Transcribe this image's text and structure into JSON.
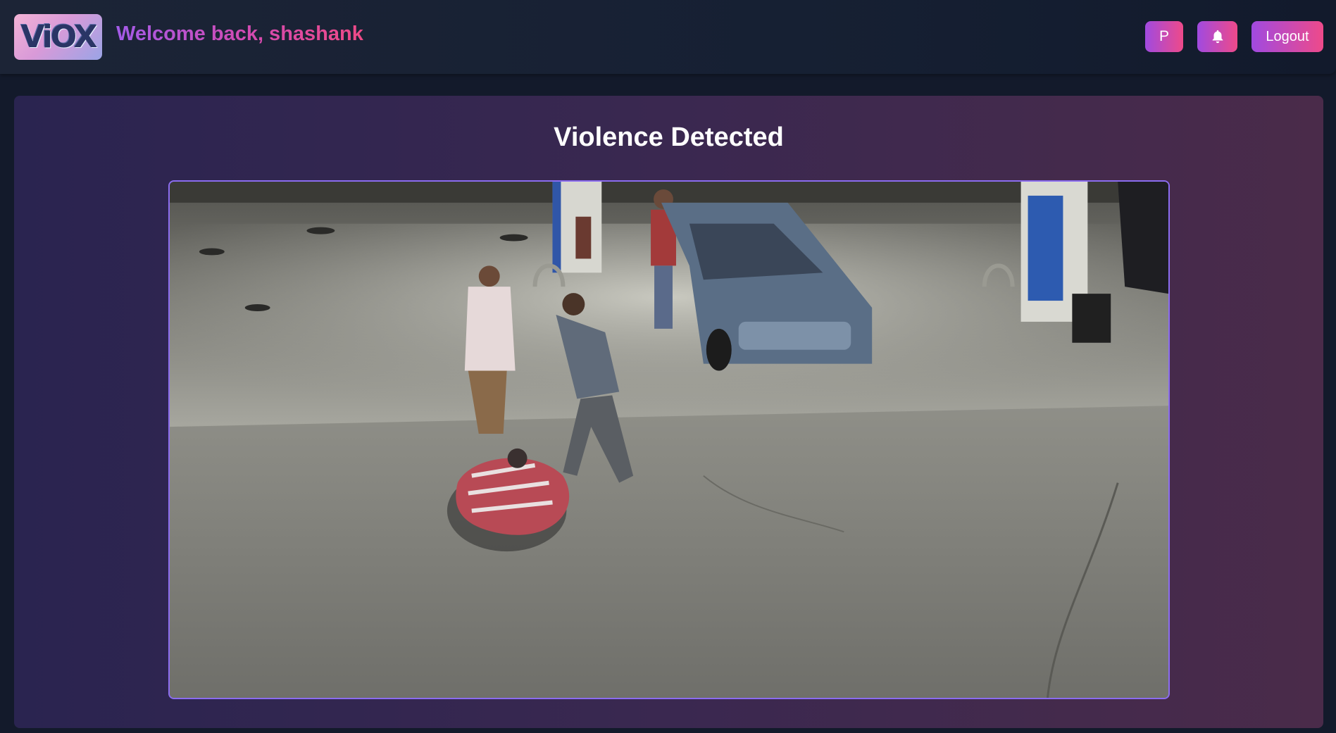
{
  "header": {
    "logo_text": "ViOX",
    "welcome_text": "Welcome back, shashank",
    "profile_button_label": "P",
    "notification_icon": "bell-icon",
    "logout_button_label": "Logout"
  },
  "main": {
    "title": "Violence Detected"
  },
  "colors": {
    "accent_start": "#a04ae0",
    "accent_end": "#ee4a8a",
    "video_border": "#8b6cf0"
  }
}
